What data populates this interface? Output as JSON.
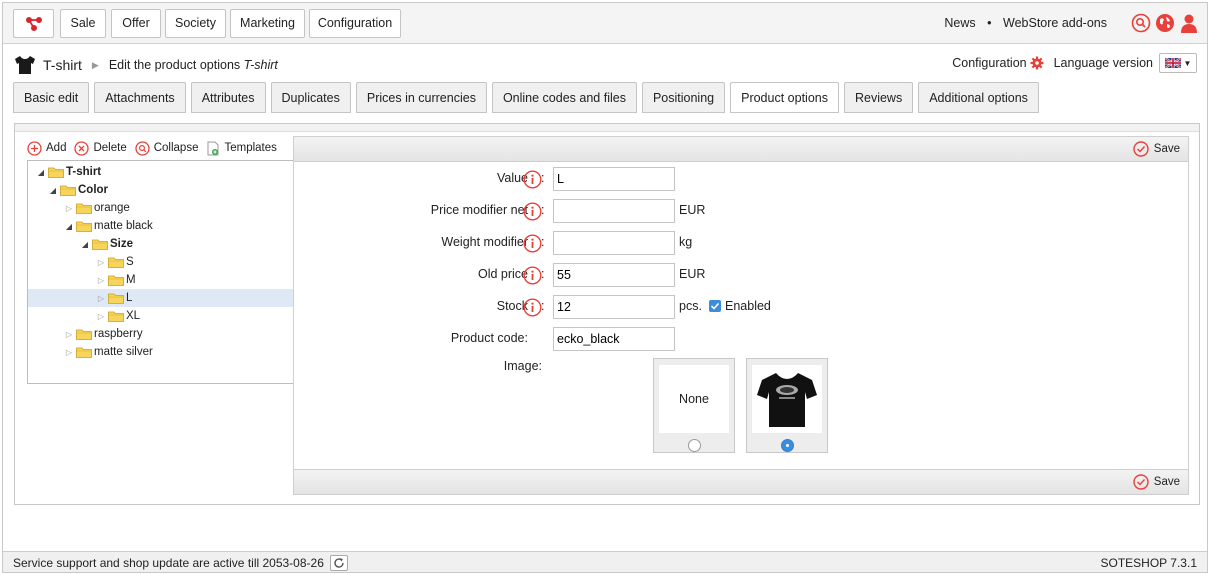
{
  "topnav": {
    "menu": [
      "Sale",
      "Offer",
      "Society",
      "Marketing",
      "Configuration"
    ],
    "links": {
      "news": "News",
      "separator": "•",
      "addons": "WebStore add-ons"
    },
    "icon_colors": {
      "accent": "#e8403a"
    }
  },
  "breadcrumb": {
    "product": "T-shirt",
    "page": "Edit the product options",
    "page_subject": "T-shirt"
  },
  "header_right": {
    "configuration": "Configuration",
    "language_version": "Language version"
  },
  "tabs": [
    "Basic edit",
    "Attachments",
    "Attributes",
    "Duplicates",
    "Prices in currencies",
    "Online codes and files",
    "Positioning",
    "Product options",
    "Reviews",
    "Additional options"
  ],
  "active_tab": "Product options",
  "tree_toolbar": {
    "add": "Add",
    "delete": "Delete",
    "collapse": "Collapse",
    "templates": "Templates"
  },
  "tree": [
    {
      "label": "T-shirt",
      "bold": true,
      "expanded": true,
      "level": 0
    },
    {
      "label": "Color",
      "bold": true,
      "expanded": true,
      "level": 1
    },
    {
      "label": "orange",
      "bold": false,
      "expanded": false,
      "level": 2
    },
    {
      "label": "matte black",
      "bold": false,
      "expanded": true,
      "level": 2
    },
    {
      "label": "Size",
      "bold": true,
      "expanded": true,
      "level": 3
    },
    {
      "label": "S",
      "bold": false,
      "expanded": false,
      "level": 4
    },
    {
      "label": "M",
      "bold": false,
      "expanded": false,
      "level": 4
    },
    {
      "label": "L",
      "bold": false,
      "expanded": false,
      "level": 4,
      "selected": true
    },
    {
      "label": "XL",
      "bold": false,
      "expanded": false,
      "level": 4
    },
    {
      "label": "raspberry",
      "bold": false,
      "expanded": false,
      "level": 2
    },
    {
      "label": "matte silver",
      "bold": false,
      "expanded": false,
      "level": 2
    }
  ],
  "form": {
    "save_label": "Save",
    "fields": {
      "value": {
        "label": "Value",
        "value": "L",
        "unit": ""
      },
      "price_modifier": {
        "label": "Price modifier net",
        "value": "",
        "unit": "EUR"
      },
      "weight_modifier": {
        "label": "Weight modifier",
        "value": "",
        "unit": "kg"
      },
      "old_price": {
        "label": "Old price",
        "value": "55",
        "unit": "EUR"
      },
      "stock": {
        "label": "Stock",
        "value": "12",
        "unit": "pcs.",
        "enabled_label": "Enabled",
        "enabled": true
      },
      "product_code": {
        "label": "Product code",
        "value": "ecko_black"
      }
    },
    "image": {
      "label": "Image:",
      "none_label": "None",
      "selected": "t-shirt-image"
    }
  },
  "status": {
    "support": "Service support and shop update are active till 2053-08-26",
    "version": "SOTESHOP 7.3.1"
  }
}
